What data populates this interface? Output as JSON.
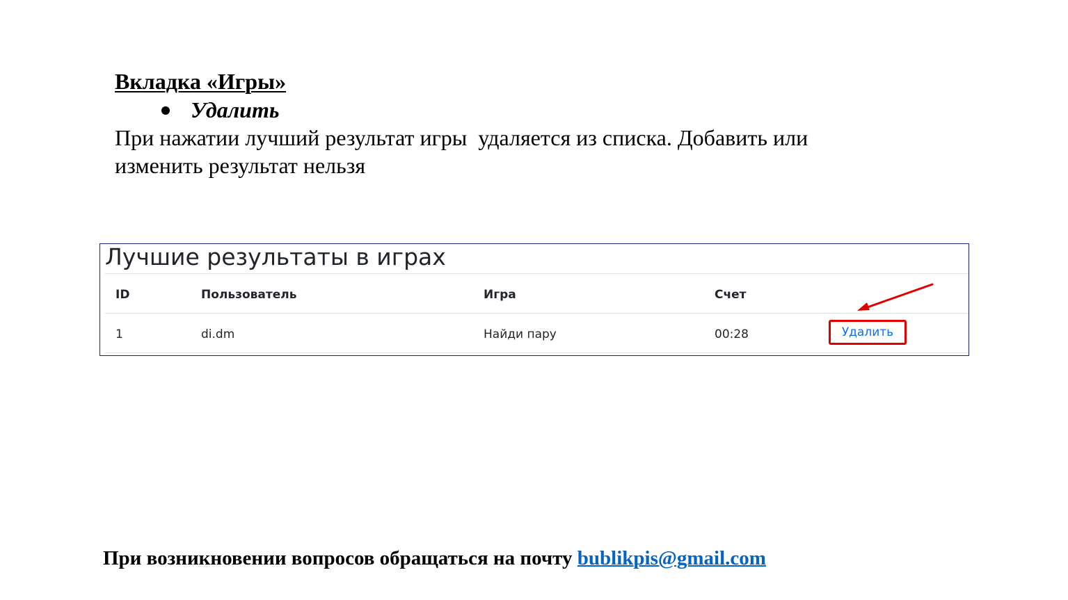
{
  "heading": "Вкладка «Игры»",
  "bullet": "Удалить",
  "paragraph_lines": [
    "При нажатии лучший результат игры  удаляется из списка. Добавить или",
    "изменить результат нельзя"
  ],
  "screenshot": {
    "title": "Лучшие результаты в играх",
    "headers": {
      "id": "ID",
      "user": "Пользователь",
      "game": "Игра",
      "score": "Счет"
    },
    "rows": [
      {
        "id": "1",
        "user": "di.dm",
        "game": "Найди пару",
        "score": "00:28",
        "action": "Удалить"
      }
    ],
    "annotation_color": "#e00000",
    "link_color": "#0d6efd"
  },
  "footer": {
    "text": "При возникновении вопросов обращаться на почту ",
    "email": "bublikpis@gmail.com"
  }
}
